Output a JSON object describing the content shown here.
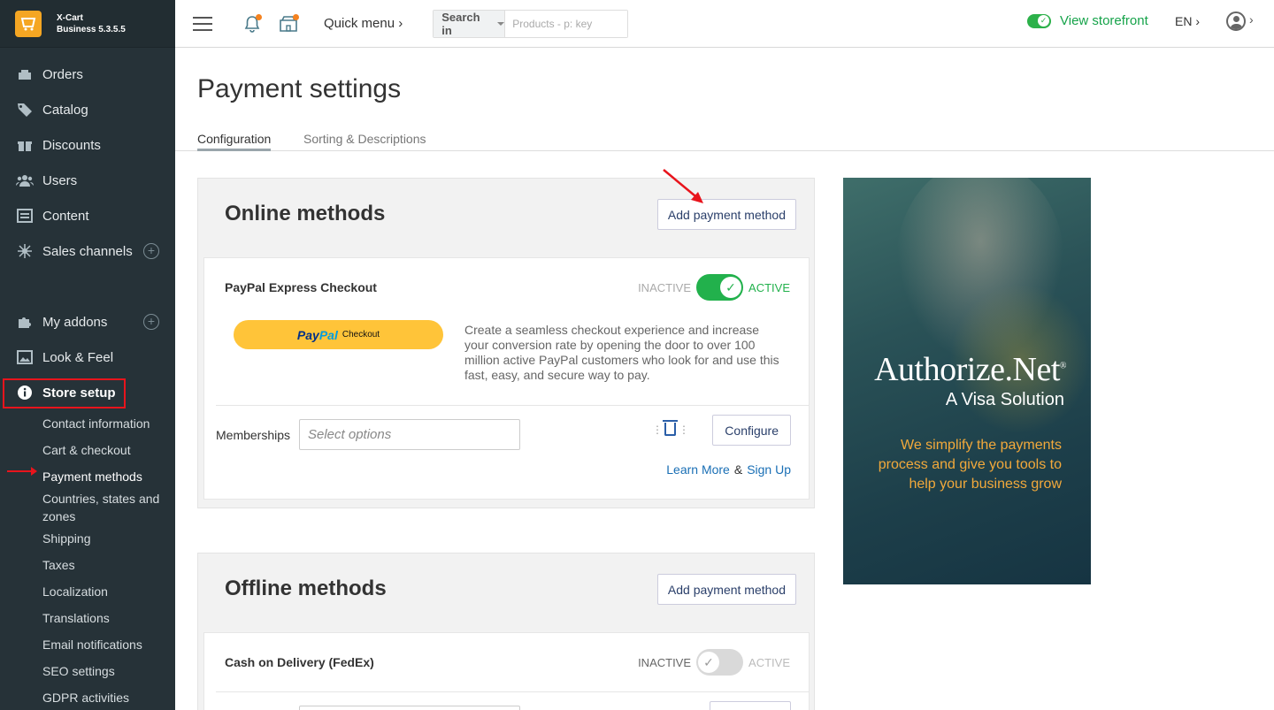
{
  "app": {
    "brand_line1": "X-Cart",
    "brand_line2": "Business 5.3.5.5"
  },
  "sidebar": {
    "items": [
      {
        "label": "Orders",
        "icon": "orders-icon"
      },
      {
        "label": "Catalog",
        "icon": "tag-icon"
      },
      {
        "label": "Discounts",
        "icon": "gift-icon"
      },
      {
        "label": "Users",
        "icon": "users-icon"
      },
      {
        "label": "Content",
        "icon": "content-icon"
      },
      {
        "label": "Sales channels",
        "icon": "network-icon"
      }
    ],
    "items2": [
      {
        "label": "My addons",
        "icon": "puzzle-icon"
      },
      {
        "label": "Look & Feel",
        "icon": "image-icon"
      },
      {
        "label": "Store setup",
        "icon": "info-icon"
      }
    ],
    "subitems": [
      "Contact information",
      "Cart & checkout",
      "Payment methods",
      "Countries, states and zones",
      "Shipping",
      "Taxes",
      "Localization",
      "Translations",
      "Email notifications",
      "SEO settings",
      "GDPR activities"
    ]
  },
  "topbar": {
    "quick_menu": "Quick menu",
    "search_in": "Search in",
    "search_placeholder": "Products - p: key",
    "view_storefront": "View storefront",
    "lang": "EN"
  },
  "page": {
    "title": "Payment settings",
    "tabs": [
      "Configuration",
      "Sorting & Descriptions"
    ]
  },
  "online": {
    "title": "Online methods",
    "add_label": "Add payment method",
    "method": {
      "name": "PayPal Express Checkout",
      "inactive": "INACTIVE",
      "active": "ACTIVE",
      "enabled": true,
      "paypal_text1": "Pay",
      "paypal_text2": "Pal",
      "paypal_text3": "Checkout",
      "description": "Create a seamless checkout experience and increase your conversion rate by opening the door to over 100 million active PayPal customers who look for and use this fast, easy, and secure way to pay.",
      "memberships_label": "Memberships",
      "memberships_placeholder": "Select options",
      "configure_label": "Configure",
      "learn_more": "Learn More",
      "amp": "&",
      "sign_up": "Sign Up"
    }
  },
  "offline": {
    "title": "Offline methods",
    "add_label": "Add payment method",
    "method": {
      "name": "Cash on Delivery (FedEx)",
      "inactive": "INACTIVE",
      "active": "ACTIVE",
      "enabled": false
    }
  },
  "ad": {
    "brand": "Authorize.Net",
    "brand_mark": "®",
    "sub": "A Visa Solution",
    "tagline": "We simplify the payments process and give you tools to help your business grow"
  },
  "colors": {
    "sidebar_bg": "#263238",
    "accent_green": "#22b14c",
    "link_blue": "#1a6fb5",
    "annotation_red": "#e8141c",
    "ad_tagline": "#f2a93b"
  }
}
